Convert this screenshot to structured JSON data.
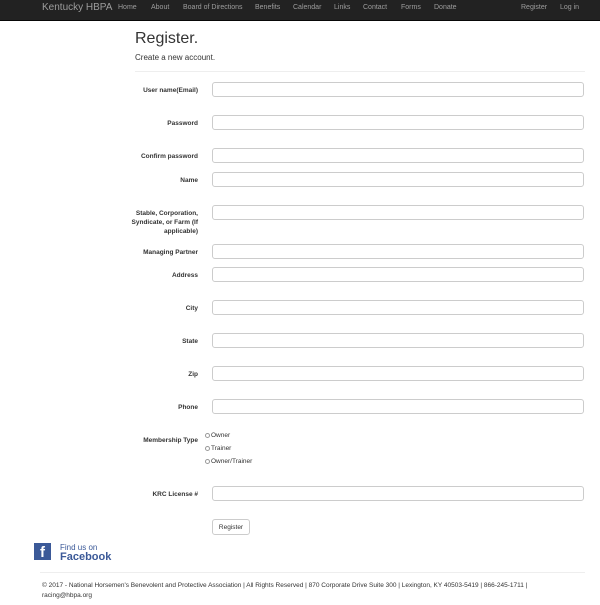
{
  "navbar": {
    "brand": "Kentucky HBPA",
    "links": [
      "Home",
      "About",
      "Board of Directions",
      "Benefits",
      "Calendar",
      "Links",
      "Contact",
      "Forms",
      "Donate"
    ],
    "right_links": [
      "Register",
      "Log in"
    ]
  },
  "page": {
    "title": "Register.",
    "subtitle": "Create a new account."
  },
  "form": {
    "fields": [
      {
        "label": "User name(Email)",
        "value": ""
      },
      {
        "label": "Password",
        "value": ""
      },
      {
        "label": "Confirm password",
        "value": ""
      },
      {
        "label": "Name",
        "value": ""
      },
      {
        "label": "Stable, Corporation, Syndicate, or Farm (If applicable)",
        "value": ""
      },
      {
        "label": "Managing Partner",
        "value": ""
      },
      {
        "label": "Address",
        "value": ""
      },
      {
        "label": "City",
        "value": ""
      },
      {
        "label": "State",
        "value": ""
      },
      {
        "label": "Zip",
        "value": ""
      },
      {
        "label": "Phone",
        "value": ""
      }
    ],
    "membership_label": "Membership Type",
    "membership_options": [
      "Owner",
      "Trainer",
      "Owner/Trainer"
    ],
    "krc_label": "KRC License #",
    "krc_value": "",
    "submit_label": "Register"
  },
  "facebook": {
    "line1": "Find us on",
    "line2": "Facebook",
    "logo_letter": "f"
  },
  "footer": {
    "text": "© 2017 - National Horsemen's Benevolent and Protective Association | All Rights Reserved | 870 Corporate Drive Suite 300 | Lexington, KY 40503-5419 | 866-245-1711 | racing@hbpa.org"
  }
}
